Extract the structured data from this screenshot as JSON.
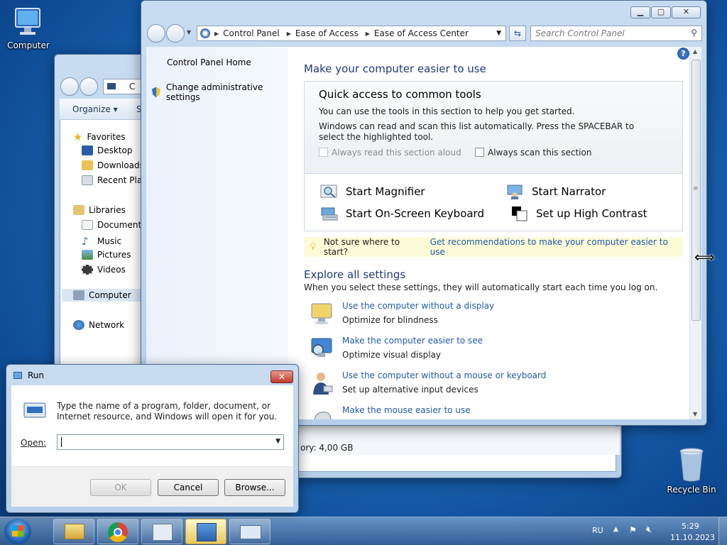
{
  "desktop": {
    "computer_label": "Computer",
    "recycle_label": "Recycle Bin"
  },
  "explorer": {
    "toolbar": {
      "organize": "Organize ▾",
      "next_item_initial": "S"
    },
    "address_initial": "C",
    "nav": {
      "favorites": "Favorites",
      "desktop": "Desktop",
      "downloads": "Downloads",
      "recent": "Recent Places",
      "libraries": "Libraries",
      "documents": "Documents",
      "music": "Music",
      "pictures": "Pictures",
      "videos": "Videos",
      "computer": "Computer",
      "network": "Network"
    },
    "memory_text": "ory: 4,00 GB"
  },
  "cpanel": {
    "breadcrumb": [
      "Control Panel",
      "Ease of Access",
      "Ease of Access Center"
    ],
    "search_placeholder": "Search Control Panel",
    "left": {
      "home": "Control Panel Home",
      "admin": "Change administrative settings"
    },
    "main": {
      "heading": "Make your computer easier to use",
      "qa_title": "Quick access to common tools",
      "qa_desc1": "You can use the tools in this section to help you get started.",
      "qa_desc2": "Windows can read and scan this list automatically.  Press the SPACEBAR to select the highlighted tool.",
      "chk_read": "Always read this section aloud",
      "chk_scan": "Always scan this section",
      "tools": {
        "magnifier": "Start Magnifier",
        "narrator": "Start Narrator",
        "keyboard": "Start On-Screen Keyboard",
        "contrast": "Set up High Contrast"
      },
      "tip_question": "Not sure where to start?",
      "tip_link": "Get recommendations to make your computer easier to use",
      "explore_heading": "Explore all settings",
      "explore_desc": "When you select these settings, they will automatically start each time you log on.",
      "settings": [
        {
          "link": "Use the computer without a display",
          "desc": "Optimize for blindness"
        },
        {
          "link": "Make the computer easier to see",
          "desc": "Optimize visual display"
        },
        {
          "link": "Use the computer without a mouse or keyboard",
          "desc": "Set up alternative input devices"
        },
        {
          "link": "Make the mouse easier to use",
          "desc": ""
        }
      ]
    }
  },
  "run": {
    "title": "Run",
    "description": "Type the name of a program, folder, document, or Internet resource, and Windows will open it for you.",
    "open_label": "Open:",
    "open_value": "",
    "ok": "OK",
    "cancel": "Cancel",
    "browse": "Browse..."
  },
  "taskbar": {
    "lang": "RU",
    "time": "5:29",
    "date": "11.10.2023"
  }
}
